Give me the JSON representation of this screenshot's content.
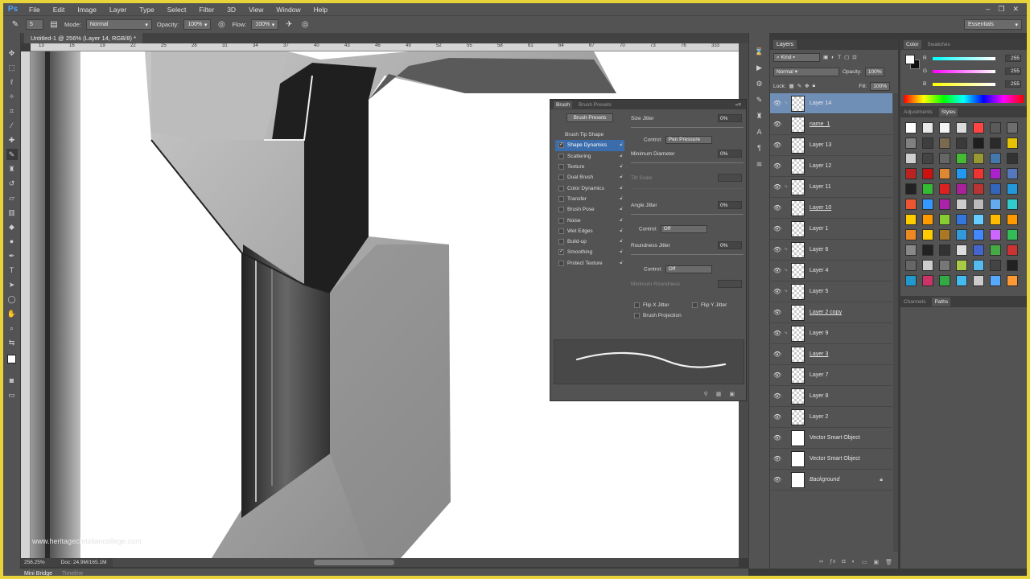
{
  "app": {
    "logo": "Ps"
  },
  "menu": [
    "File",
    "Edit",
    "Image",
    "Layer",
    "Type",
    "Select",
    "Filter",
    "3D",
    "View",
    "Window",
    "Help"
  ],
  "window_controls": [
    "–",
    "❐",
    "✕"
  ],
  "options_bar": {
    "brush_size": "5",
    "mode_label": "Mode:",
    "mode_value": "Normal",
    "opacity_label": "Opacity:",
    "opacity_value": "100%",
    "flow_label": "Flow:",
    "flow_value": "100%",
    "workspace": "Essentials"
  },
  "document": {
    "tab_title": "Untitled-1 @ 256% (Layer 14, RGB/8) *",
    "ruler_ticks": [
      "13",
      "16",
      "19",
      "22",
      "25",
      "28",
      "31",
      "34",
      "37",
      "40",
      "43",
      "46",
      "49",
      "52",
      "55",
      "58",
      "61",
      "64",
      "67",
      "70",
      "73",
      "76",
      "333"
    ],
    "watermark": "www.heritagechristiancollege.com"
  },
  "status": {
    "zoom": "256.25%",
    "doc_size": "Doc: 24.9M/165.1M"
  },
  "bottom_tabs": {
    "active": "Mini Bridge",
    "inactive": "Timeline"
  },
  "brush_panel": {
    "tab_brush": "Brush",
    "tab_presets": "Brush Presets",
    "presets_button": "Brush Presets",
    "header": "Brush Tip Shape",
    "items": [
      {
        "label": "Shape Dynamics",
        "checked": true,
        "selected": true
      },
      {
        "label": "Scattering",
        "checked": false
      },
      {
        "label": "Texture",
        "checked": false
      },
      {
        "label": "Dual Brush",
        "checked": false
      },
      {
        "label": "Color Dynamics",
        "checked": false
      },
      {
        "label": "Transfer",
        "checked": false
      },
      {
        "label": "Brush Pose",
        "checked": false
      },
      {
        "label": "Noise",
        "checked": false
      },
      {
        "label": "Wet Edges",
        "checked": false
      },
      {
        "label": "Build-up",
        "checked": false
      },
      {
        "label": "Smoothing",
        "checked": true
      },
      {
        "label": "Protect Texture",
        "checked": false
      }
    ],
    "size_jitter_label": "Size Jitter",
    "size_jitter_value": "0%",
    "control_label": "Control:",
    "control_1": "Pen Pressure",
    "min_diameter_label": "Minimum Diameter",
    "min_diameter_value": "0%",
    "tilt_scale_label": "Tilt Scale",
    "angle_jitter_label": "Angle Jitter",
    "angle_jitter_value": "0%",
    "control_2": "Off",
    "roundness_jitter_label": "Roundness Jitter",
    "roundness_jitter_value": "0%",
    "control_3": "Off",
    "min_roundness_label": "Minimum Roundness",
    "flip_x": "Flip X Jitter",
    "flip_y": "Flip Y Jitter",
    "brush_projection": "Brush Projection"
  },
  "layers_panel": {
    "tab": "Layers",
    "kind": "Kind",
    "blend_mode": "Normal",
    "opacity_label": "Opacity:",
    "opacity_value": "100%",
    "lock_label": "Lock:",
    "fill_label": "Fill:",
    "fill_value": "100%",
    "layers": [
      {
        "name": "Layer 14",
        "selected": true,
        "linked": true
      },
      {
        "name": "name_1",
        "underline": true
      },
      {
        "name": "Layer 13"
      },
      {
        "name": "Layer 12"
      },
      {
        "name": "Layer 11",
        "linked": true
      },
      {
        "name": "Layer 10",
        "underline": true
      },
      {
        "name": "Layer 1"
      },
      {
        "name": "Layer 6",
        "linked": true
      },
      {
        "name": "Layer 4",
        "linked": true
      },
      {
        "name": "Layer 5",
        "linked": true
      },
      {
        "name": "Layer 2 copy",
        "underline": true
      },
      {
        "name": "Layer 9",
        "linked": true
      },
      {
        "name": "Layer 3",
        "underline": true
      },
      {
        "name": "Layer 7"
      },
      {
        "name": "Layer 8"
      },
      {
        "name": "Layer 2"
      },
      {
        "name": "Vector Smart Object",
        "smart": true
      },
      {
        "name": "Vector Smart Object",
        "smart": true
      },
      {
        "name": "Background",
        "italic": true,
        "locked": true
      }
    ]
  },
  "color_panel": {
    "tab_color": "Color",
    "tab_swatches": "Swatches",
    "channels": [
      {
        "ch": "R",
        "value": "255"
      },
      {
        "ch": "G",
        "value": "255"
      },
      {
        "ch": "B",
        "value": "255"
      }
    ]
  },
  "styles_panel": {
    "tab_adjustments": "Adjustments",
    "tab_styles": "Styles"
  },
  "channels_panel": {
    "tab_channels": "Channels",
    "tab_paths": "Paths"
  },
  "colors": {
    "frame": "#e8d33a",
    "ui_bg": "#535353",
    "selection": "#6f8fb7"
  }
}
